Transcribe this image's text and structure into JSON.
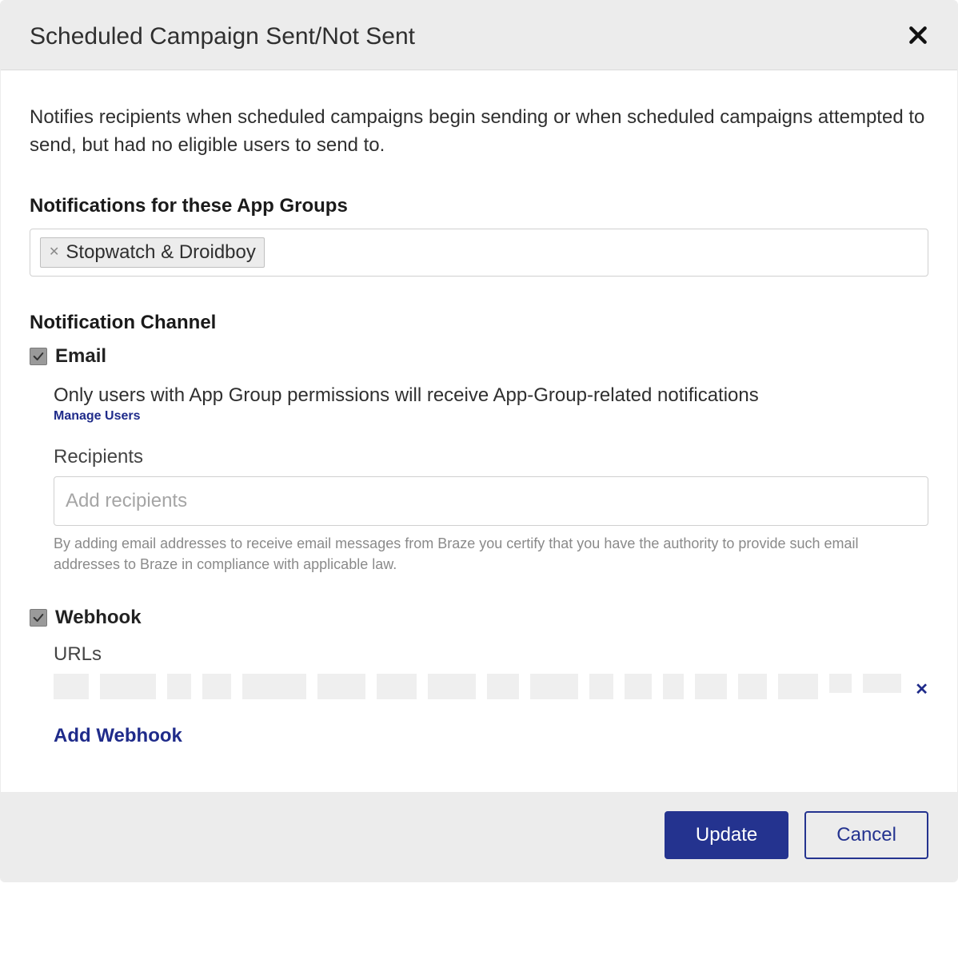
{
  "header": {
    "title": "Scheduled Campaign Sent/Not Sent"
  },
  "body": {
    "description": "Notifies recipients when scheduled campaigns begin sending or when scheduled campaigns attempted to send, but had no eligible users to send to.",
    "app_groups_label": "Notifications for these App Groups",
    "app_groups_tag": "Stopwatch & Droidboy",
    "channel_label": "Notification Channel",
    "email": {
      "label": "Email",
      "checked": true,
      "helper": "Only users with App Group permissions will receive App-Group-related notifications",
      "manage_users_link": "Manage Users",
      "recipients_label": "Recipients",
      "recipients_placeholder": "Add recipients",
      "legal": "By adding email addresses to receive email messages from Braze you certify that you have the authority to provide such email addresses to Braze in compliance with applicable law."
    },
    "webhook": {
      "label": "Webhook",
      "checked": true,
      "urls_label": "URLs",
      "add_webhook_label": "Add Webhook"
    }
  },
  "footer": {
    "update_label": "Update",
    "cancel_label": "Cancel"
  }
}
